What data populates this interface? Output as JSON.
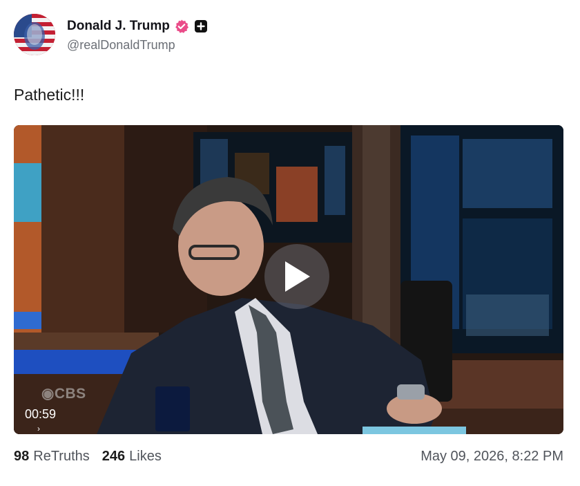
{
  "author": {
    "display_name": "Donald J. Trump",
    "handle": "@realDonaldTrump",
    "verified_color": "#ea4c89",
    "badge_icon": "plus-square-icon"
  },
  "post": {
    "text": "Pathetic!!!"
  },
  "video": {
    "watermark": "CBS",
    "duration": "00:59",
    "play_icon": "play-icon"
  },
  "footer": {
    "retruths_count": "98",
    "retruths_label": "ReTruths",
    "likes_count": "246",
    "likes_label": "Likes",
    "timestamp": "May 09, 2026, 8:22 PM"
  }
}
